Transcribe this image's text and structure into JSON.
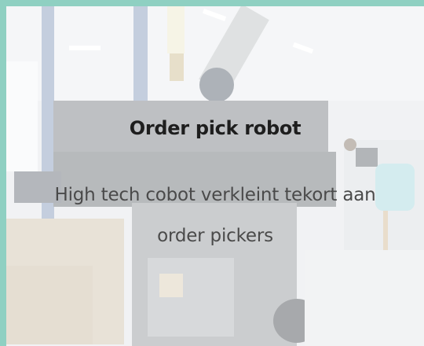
{
  "card": {
    "title": "Order pick robot",
    "subtitle": "High tech cobot verkleint tekort aan order pickers",
    "background_image": "warehouse-robot-photo"
  },
  "colors": {
    "frame": "#8fd0c2",
    "title": "#1e1e1e",
    "subtitle": "#4a4a4a"
  }
}
